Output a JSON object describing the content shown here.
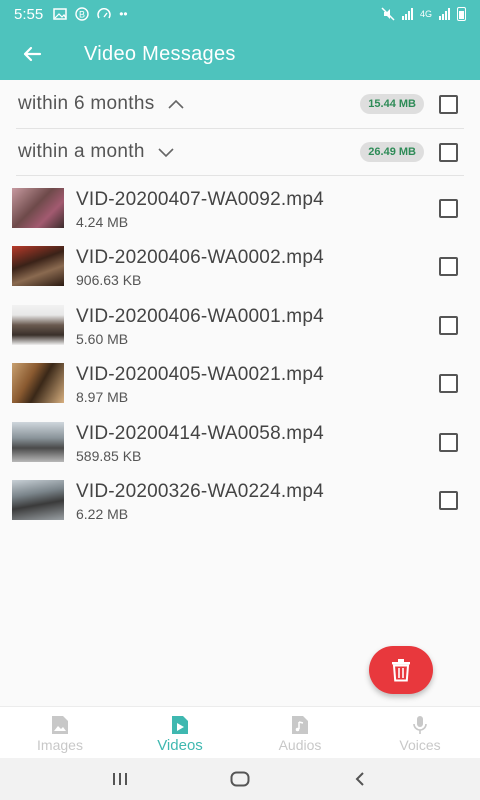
{
  "status_bar": {
    "time": "5:55",
    "network": "4G",
    "icons": [
      "gallery-icon",
      "b-icon",
      "gauge-icon",
      "more-dots-icon",
      "mute-icon",
      "signal-icon",
      "signal-icon",
      "battery-icon"
    ]
  },
  "toolbar": {
    "title": "Video Messages",
    "back_icon": "arrow-left-icon"
  },
  "groups": [
    {
      "title": "within 6 months",
      "size": "15.44 MB",
      "expanded": true
    },
    {
      "title": "within a month",
      "size": "26.49 MB",
      "expanded": false
    }
  ],
  "files": [
    {
      "name": "VID-20200407-WA0092.mp4",
      "size": "4.24 MB"
    },
    {
      "name": "VID-20200406-WA0002.mp4",
      "size": "906.63 KB"
    },
    {
      "name": "VID-20200406-WA0001.mp4",
      "size": "5.60 MB"
    },
    {
      "name": "VID-20200405-WA0021.mp4",
      "size": "8.97 MB"
    },
    {
      "name": "VID-20200414-WA0058.mp4",
      "size": "589.85 KB"
    },
    {
      "name": "VID-20200326-WA0224.mp4",
      "size": "6.22 MB"
    }
  ],
  "fab_icon": "trash-icon",
  "bottom_nav": {
    "tabs": [
      {
        "label": "Images",
        "icon": "image-file-icon",
        "active": false
      },
      {
        "label": "Videos",
        "icon": "video-file-icon",
        "active": true
      },
      {
        "label": "Audios",
        "icon": "audio-file-icon",
        "active": false
      },
      {
        "label": "Voices",
        "icon": "microphone-icon",
        "active": false
      }
    ]
  },
  "colors": {
    "primary": "#4ec3bd",
    "active_tab": "#3fb8b0",
    "fab": "#e8383d",
    "badge_text": "#2e8b57",
    "badge_bg": "#dedede"
  }
}
